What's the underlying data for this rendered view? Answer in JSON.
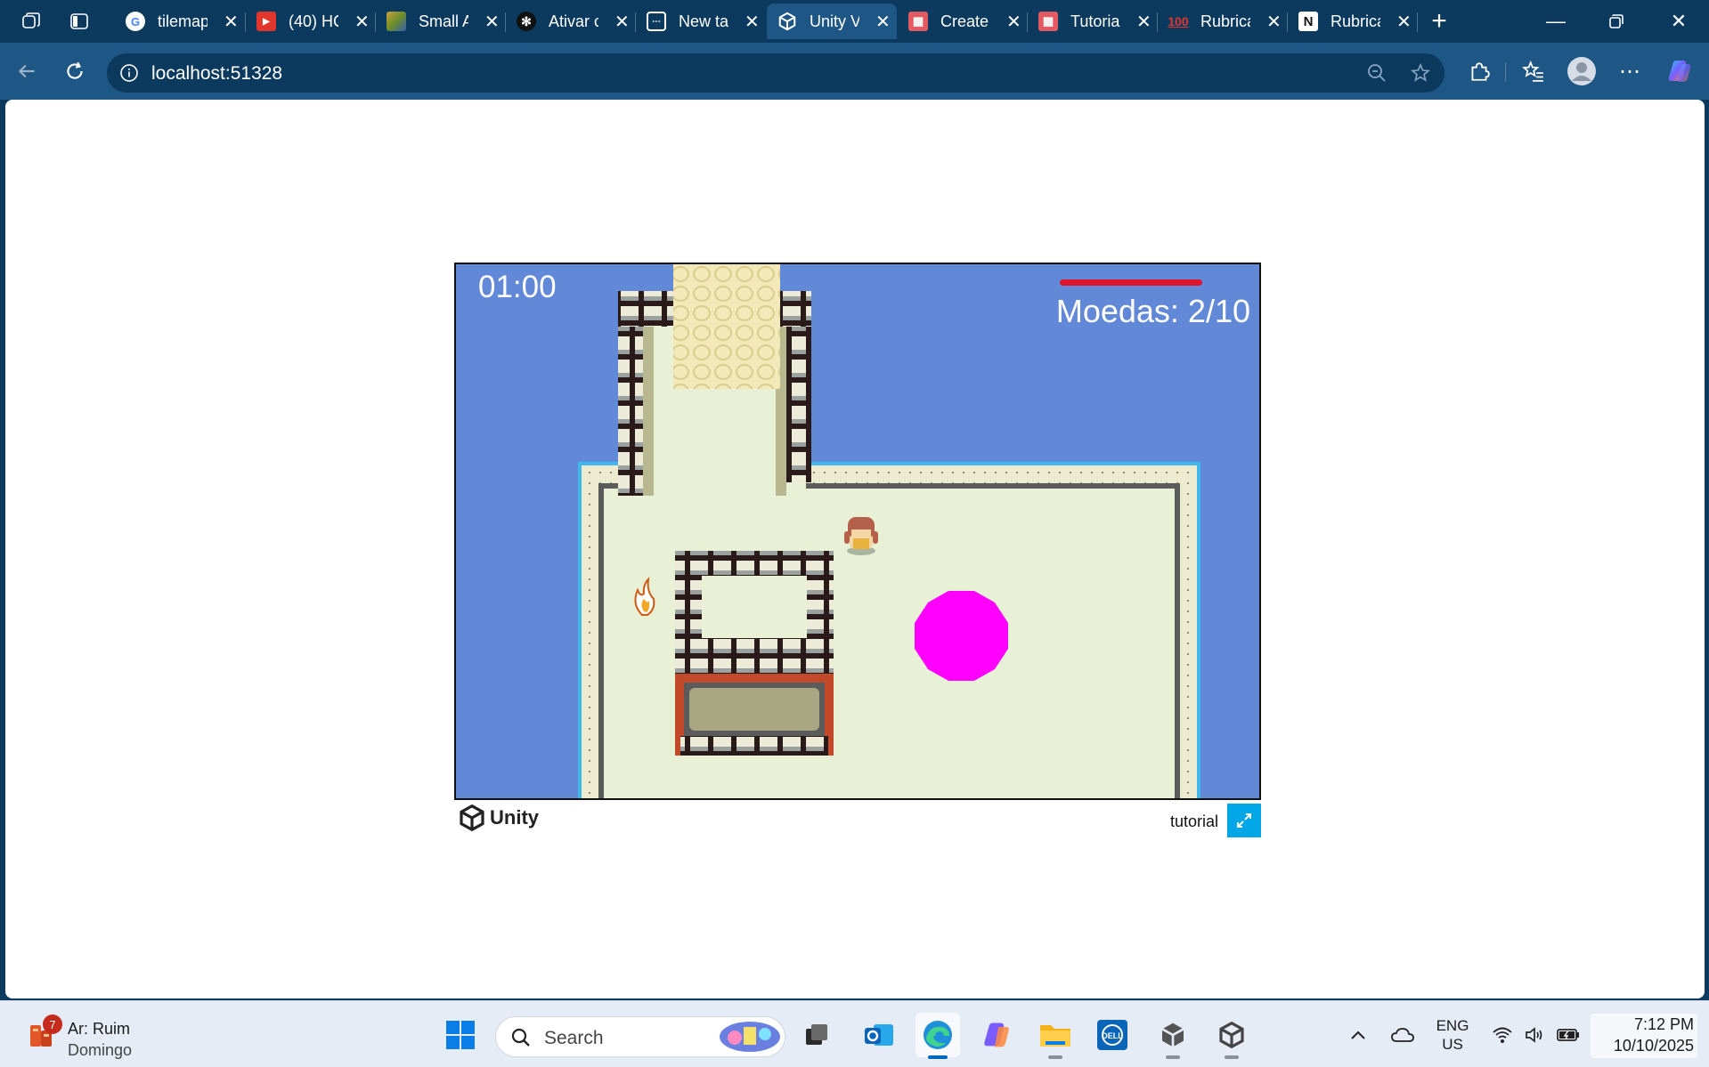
{
  "browser": {
    "tabs": [
      {
        "title": "tilemap",
        "favicon": "google-icon",
        "color": "#ffffff"
      },
      {
        "title": "(40) HC",
        "favicon": "youtube-icon",
        "color": "#e0362c"
      },
      {
        "title": "Small A",
        "favicon": "asset-thumbnail-icon",
        "color": "#8a9a2c"
      },
      {
        "title": "Ativar c",
        "favicon": "openai-icon",
        "color": "#222222"
      },
      {
        "title": "New ta",
        "favicon": "new-tab-icon",
        "color": "#ffffff"
      },
      {
        "title": "Unity V",
        "favicon": "unity-icon",
        "color": "#ffffff",
        "active": true
      },
      {
        "title": "Create",
        "favicon": "store-icon",
        "color": "#e35a62"
      },
      {
        "title": "Tutoria",
        "favicon": "store-icon",
        "color": "#e35a62"
      },
      {
        "title": "Rubrica",
        "favicon": "hundred-icon",
        "color": "#e0362c"
      },
      {
        "title": "Rubrica",
        "favicon": "notion-icon",
        "color": "#ffffff"
      }
    ],
    "url": "localhost:51328"
  },
  "game": {
    "timer": "01:00",
    "coins_text": "Moedas: 2/10",
    "health_fraction": 1.0,
    "colors": {
      "water": "#6288d8",
      "floor": "#e8f0d6",
      "path": "#f2e8b8",
      "enemy_blob": "#ff00ff",
      "health": "#e0142c"
    }
  },
  "unity": {
    "brand": "Unity",
    "title": "tutorial",
    "fullscreen_icon": "fullscreen-icon"
  },
  "taskbar": {
    "weather": {
      "badge": "7",
      "line1": "Ar: Ruim",
      "line2": "Domingo"
    },
    "search_placeholder": "Search",
    "lang": {
      "line1": "ENG",
      "line2": "US"
    },
    "time": "7:12 PM",
    "date": "10/10/2025"
  }
}
